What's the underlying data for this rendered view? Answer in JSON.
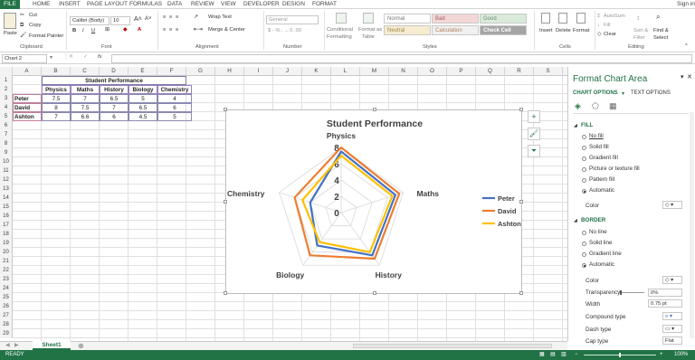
{
  "tabs": [
    "FILE",
    "HOME",
    "INSERT",
    "PAGE LAYOUT",
    "FORMULAS",
    "DATA",
    "REVIEW",
    "VIEW",
    "DEVELOPER",
    "DESIGN",
    "FORMAT"
  ],
  "sign_in": "Sign in",
  "clipboard": {
    "paste": "Paste",
    "cut": "Cut",
    "copy": "Copy",
    "format_painter": "Format Painter",
    "label": "Clipboard"
  },
  "font": {
    "name": "Calibri (Body)",
    "size": "10",
    "label": "Font",
    "bold": "B",
    "italic": "I",
    "underline": "U"
  },
  "alignment": {
    "wrap": "Wrap Text",
    "merge": "Merge & Center",
    "label": "Alignment"
  },
  "number": {
    "format": "General",
    "label": "Number"
  },
  "styles": {
    "conditional": "Conditional",
    "formatting": "Formatting",
    "format_as": "Format as",
    "table": "Table",
    "normal": "Normal",
    "bad": "Bad",
    "good": "Good",
    "neutral": "Neutral",
    "calculation": "Calculation",
    "check_cell": "Check Cell",
    "label": "Styles"
  },
  "cells": {
    "insert": "Insert",
    "delete": "Delete",
    "format": "Format",
    "label": "Cells"
  },
  "editing": {
    "autosum": "AutoSum",
    "fill": "Fill",
    "clear": "Clear",
    "sort": "Sort &",
    "filter": "Filter",
    "find": "Find &",
    "select": "Select",
    "label": "Editing"
  },
  "name_box": "Chart 2",
  "fx": "fx",
  "columns": [
    "A",
    "B",
    "C",
    "D",
    "E",
    "F",
    "G",
    "H",
    "I",
    "J",
    "K",
    "L",
    "M",
    "N",
    "O",
    "P",
    "Q",
    "R",
    "S"
  ],
  "rows": [
    "1",
    "2",
    "3",
    "4",
    "5",
    "6",
    "7",
    "8",
    "9",
    "10",
    "11",
    "12",
    "13",
    "14",
    "15",
    "16",
    "17",
    "18",
    "19",
    "20",
    "21",
    "22",
    "23",
    "24",
    "25",
    "26",
    "27",
    "28",
    "29"
  ],
  "table": {
    "title": "Student Performance",
    "headers": [
      "Physics",
      "Maths",
      "History",
      "Biology",
      "Chemistry"
    ],
    "students": [
      {
        "name": "Peter",
        "values": [
          "7.5",
          "7",
          "6.5",
          "5",
          "4"
        ]
      },
      {
        "name": "David",
        "values": [
          "8",
          "7.5",
          "7",
          "6.5",
          "6"
        ]
      },
      {
        "name": "Ashton",
        "values": [
          "7",
          "6.6",
          "6",
          "4.5",
          "5"
        ]
      }
    ]
  },
  "chart_data": {
    "type": "radar",
    "title": "Student Performance",
    "categories": [
      "Physics",
      "Maths",
      "History",
      "Biology",
      "Chemistry"
    ],
    "ticks": [
      "0",
      "2",
      "4",
      "6",
      "8"
    ],
    "rmax": 8,
    "series": [
      {
        "name": "Peter",
        "values": [
          7.5,
          7,
          6.5,
          5,
          4
        ],
        "color": "#4472c4"
      },
      {
        "name": "David",
        "values": [
          8,
          7.5,
          7,
          6.5,
          6
        ],
        "color": "#ed7d31"
      },
      {
        "name": "Ashton",
        "values": [
          7,
          6.6,
          6,
          4.5,
          5
        ],
        "color": "#ffc000"
      }
    ],
    "legend_position": "right"
  },
  "panel": {
    "title": "Format Chart Area",
    "tab_chart": "CHART OPTIONS",
    "tab_text": "TEXT OPTIONS",
    "fill_heading": "FILL",
    "fill_options": [
      "No fill",
      "Solid fill",
      "Gradient fill",
      "Picture or texture fill",
      "Pattern fill",
      "Automatic"
    ],
    "fill_selected": "Automatic",
    "color_label": "Color",
    "border_heading": "BORDER",
    "border_options": [
      "No line",
      "Solid line",
      "Gradient line",
      "Automatic"
    ],
    "border_selected": "Automatic",
    "b_color": "Color",
    "transparency": "Transparency",
    "transparency_value": "0%",
    "width": "Width",
    "width_value": "0.75 pt",
    "compound": "Compound type",
    "dash": "Dash type",
    "cap": "Cap type",
    "cap_value": "Flat"
  },
  "sheet_tab": "Sheet1",
  "status": {
    "ready": "READY",
    "zoom": "100%"
  },
  "accent": "#217346"
}
